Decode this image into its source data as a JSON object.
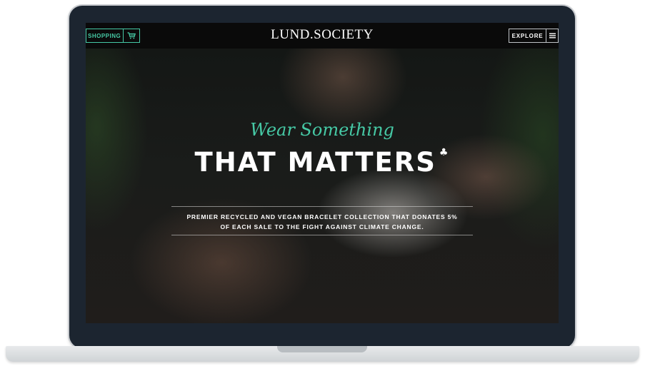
{
  "header": {
    "shopping_label": "SHOPPING",
    "cart_icon": "cart-icon",
    "logo": "LUND.SOCIETY",
    "explore_label": "EXPLORE",
    "menu_icon": "hamburger-menu-icon"
  },
  "hero": {
    "tagline": "Wear Something",
    "headline": "THAT MATTERS",
    "headline_mark": "♣",
    "subtext_line1": "PREMIER RECYCLED AND VEGAN BRACELET COLLECTION THAT DONATES 5%",
    "subtext_line2": "OF EACH SALE TO THE FIGHT AGAINST CLIMATE CHANGE."
  },
  "colors": {
    "accent": "#46c9a5",
    "header_bg": "#0a0a0a",
    "device_frame": "#1c2530"
  }
}
